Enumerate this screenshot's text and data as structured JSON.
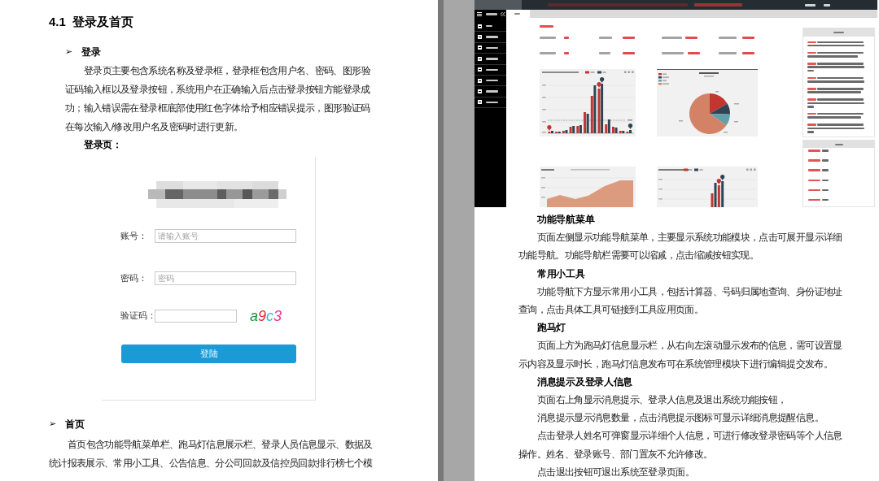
{
  "left_page": {
    "heading": "4.1  登录及首页",
    "sections": [
      {
        "bullet": "➢",
        "title": "登录",
        "paragraphs": [
          "登录页主要包含系统名称及登录框，登录框包含用户名、密码、图形验证码输入框以及登录按钮，系统用户在正确输入后点击登录按钮方能登录成功；输入错误需在登录框底部使用红色字体给予相应错误提示，图形验证码在每次输入/修改用户名及密码时进行更新。"
        ],
        "figure_label": "登录页：",
        "login_form": {
          "fields": [
            {
              "kind": "input",
              "label": "账号：",
              "placeholder": "请输入账号"
            },
            {
              "kind": "input",
              "label": "密码：",
              "placeholder": "密码"
            },
            {
              "kind": "captcha",
              "label": "验证码：",
              "captcha": [
                {
                  "char": "a",
                  "color": "#1f8f3a"
                },
                {
                  "char": "9",
                  "color": "#e3262e"
                },
                {
                  "char": "c",
                  "color": "#3ab4e2"
                },
                {
                  "char": "3",
                  "color": "#e8368f"
                }
              ]
            }
          ],
          "button": "登陆"
        }
      },
      {
        "bullet": "➢",
        "title": "首页",
        "paragraphs": [
          "首页包含功能导航菜单栏、跑马灯信息展示栏、登录人员信息显示、数据及统计报表展示、常用小工具、公告信息、分公司回款及信控员回款排行榜七个模"
        ]
      }
    ]
  },
  "right_page": {
    "sections": [
      {
        "title": "功能导航菜单",
        "paragraphs": [
          "页面左侧显示功能导航菜单，主要显示系统功能模块，点击可展开显示详细功能导航。功能导航栏需要可以缩减，点击缩减按钮实现。"
        ]
      },
      {
        "title": "常用小工具",
        "paragraphs": [
          "功能导航下方显示常用小工具，包括计算器、号码归属地查询、身份证地址查询，点击具体工具可链接到工具应用页面。"
        ]
      },
      {
        "title": "跑马灯",
        "paragraphs": [
          "页面上方为跑马灯信息显示栏，从右向左滚动显示发布的信息，需可设置显示内容及显示时长，跑马灯信息发布可在系统管理模块下进行编辑提交发布。"
        ]
      },
      {
        "title": "消息提示及登录人信息",
        "paragraphs": [
          "页面右上角显示消息提示、登录人信息及退出系统功能按钮，",
          "消息提示显示消息数量，点击消息提示图标可显示详细消息提醒信息。",
          "点击登录人姓名可弹窗显示详细个人信息，可进行修改登录密码等个人信息操作。姓名、登录账号、部门置灰不允许修改。",
          "点击退出按钮可退出系统至登录页面。"
        ]
      }
    ]
  }
}
